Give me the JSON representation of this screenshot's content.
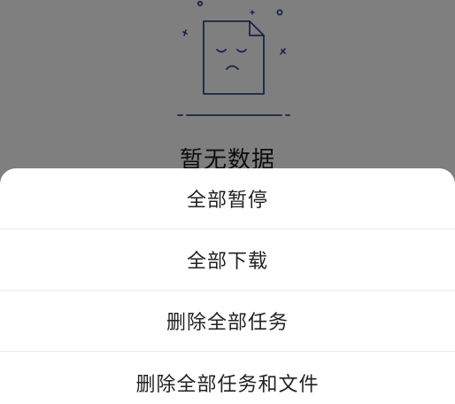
{
  "empty_state": {
    "text": "暂无数据",
    "icon": "sad-document-icon",
    "illustration_color": "#2b4a8f"
  },
  "overlay_color": "rgba(0,0,0,0.5)",
  "action_sheet": {
    "items": [
      {
        "label": "全部暂停"
      },
      {
        "label": "全部下载"
      },
      {
        "label": "删除全部任务"
      },
      {
        "label": "删除全部任务和文件"
      }
    ]
  }
}
